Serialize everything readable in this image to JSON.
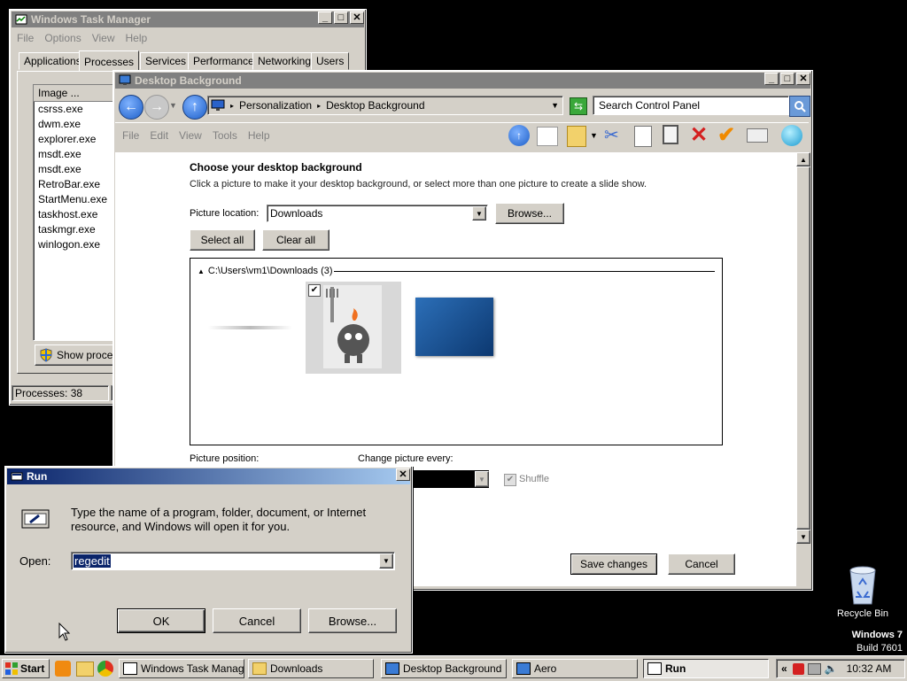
{
  "taskmgr": {
    "title": "Windows Task Manager",
    "menu": [
      "File",
      "Options",
      "View",
      "Help"
    ],
    "tabs": [
      "Applications",
      "Processes",
      "Services",
      "Performance",
      "Networking",
      "Users"
    ],
    "column_header": "Image ...",
    "processes": [
      "csrss.exe",
      "dwm.exe",
      "explorer.exe",
      "msdt.exe",
      "msdt.exe",
      "RetroBar.exe",
      "StartMenu.exe",
      "taskhost.exe",
      "taskmgr.exe",
      "winlogon.exe"
    ],
    "show_processes_label": "Show process",
    "status_processes": "Processes: 38"
  },
  "desktop_bg": {
    "title": "Desktop Background",
    "breadcrumb": [
      "Personalization",
      "Desktop Background"
    ],
    "search_placeholder": "Search Control Panel",
    "menu": [
      "File",
      "Edit",
      "View",
      "Tools",
      "Help"
    ],
    "heading": "Choose your desktop background",
    "subtext": "Click a picture to make it your desktop background, or select more than one picture to create a slide show.",
    "picture_location_label": "Picture location:",
    "picture_location_value": "Downloads",
    "browse_label": "Browse...",
    "select_all_label": "Select all",
    "clear_all_label": "Clear all",
    "group_label": "C:\\Users\\vm1\\Downloads (3)",
    "picture_position_label": "Picture position:",
    "change_picture_label": "Change picture every:",
    "shuffle_label": "Shuffle",
    "save_label": "Save changes",
    "cancel_label": "Cancel"
  },
  "run": {
    "title": "Run",
    "description": "Type the name of a program, folder, document, or Internet resource, and Windows will open it for you.",
    "open_label": "Open:",
    "open_value": "regedit",
    "ok_label": "OK",
    "cancel_label": "Cancel",
    "browse_label": "Browse..."
  },
  "desktop": {
    "recycle_bin_label": "Recycle Bin",
    "watermark_line1": "Windows 7",
    "watermark_line2": "Build 7601"
  },
  "taskbar": {
    "start_label": "Start",
    "tasks": [
      "Windows Task Manager",
      "Downloads",
      "Desktop Background",
      "Aero",
      "Run"
    ],
    "chevron": "«",
    "clock": "10:32 AM"
  },
  "colors": {
    "active_title": "#0a246a",
    "inactive_title": "#808080",
    "selection": "#0a246a"
  }
}
